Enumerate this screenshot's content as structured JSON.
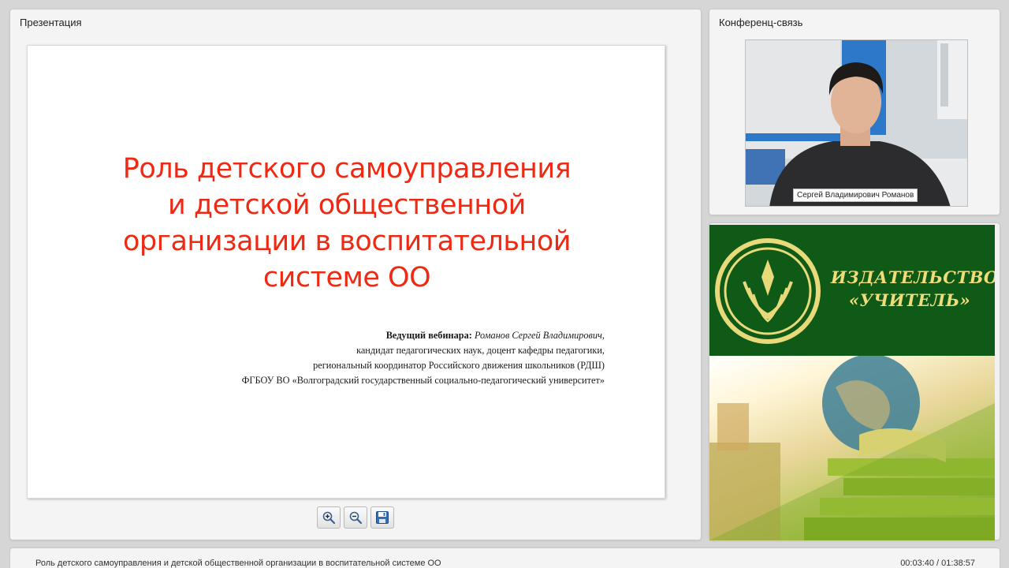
{
  "presentation": {
    "panel_title": "Презентация",
    "slide": {
      "title_lines": [
        "Роль детского самоуправления",
        "и детской общественной",
        "организации в воспитательной",
        "системе ОО"
      ],
      "lead_label": "Ведущий вебинара:",
      "lead_name": "Романов Сергей Владимирович,",
      "info_lines": [
        "кандидат педагогических наук, доцент кафедры педагогики,",
        "региональный координатор Российского движения школьников (РДШ)",
        "ФГБОУ ВО «Волгоградский государственный социально-педагогический университет»"
      ],
      "title_color": "#ee2a14"
    },
    "toolbar": {
      "zoom_in_icon": "zoom-in-icon",
      "zoom_out_icon": "zoom-out-icon",
      "save_icon": "floppy-disk-icon"
    }
  },
  "conference": {
    "panel_title": "Конференц-связь",
    "participant_name": "Сергей Владимирович Романов"
  },
  "ad": {
    "brand_lines": [
      "ИЗДАТЕЛЬСТВО",
      "«УЧИТЕЛЬ»"
    ],
    "brand_color": "#f0dc7a",
    "background_color": "#0f5a16"
  },
  "status": {
    "title": "Роль детского самоуправления и детской общественной организации в воспитательной системе ОО",
    "time": "00:03:40 / 01:38:57"
  }
}
